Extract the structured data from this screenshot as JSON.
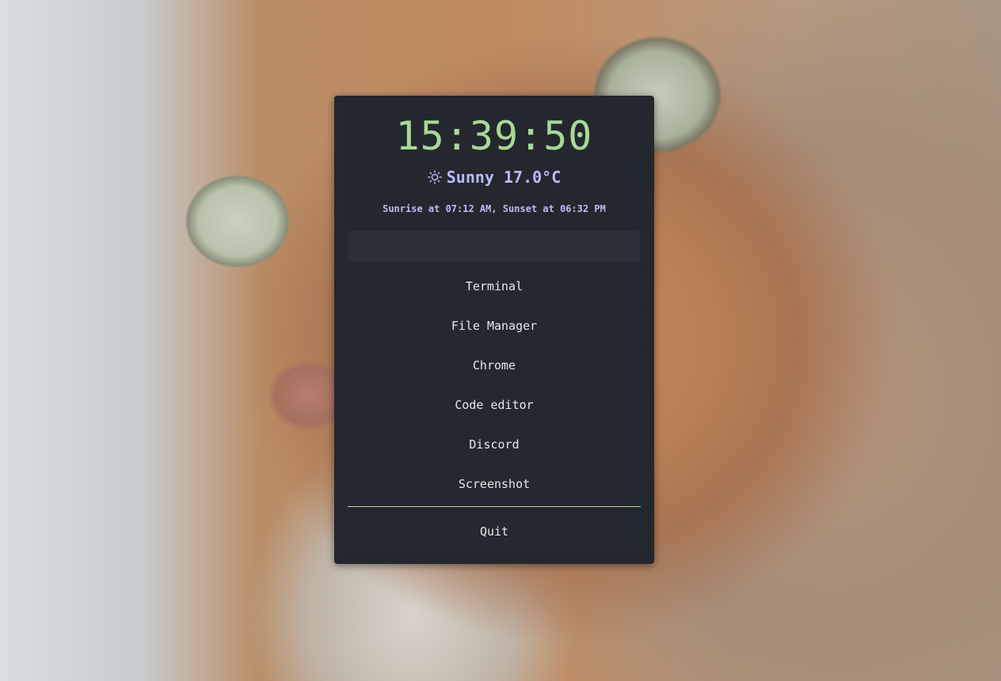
{
  "launcher": {
    "clock": "15:39:50",
    "weather": {
      "icon": "sun-icon",
      "text": "Sunny 17.0°C"
    },
    "sun_times": "Sunrise at 07:12 AM, Sunset at 06:32 PM",
    "search": {
      "value": "",
      "placeholder": ""
    },
    "items": [
      {
        "label": "Terminal"
      },
      {
        "label": "File Manager"
      },
      {
        "label": "Chrome"
      },
      {
        "label": "Code editor"
      },
      {
        "label": "Discord"
      },
      {
        "label": "Screenshot"
      }
    ],
    "quit_label": "Quit"
  },
  "colors": {
    "panel_bg": "#25272f",
    "clock_green": "#a6da95",
    "accent_lavender": "#b7bdf8",
    "item_text": "#e8e8ee"
  }
}
